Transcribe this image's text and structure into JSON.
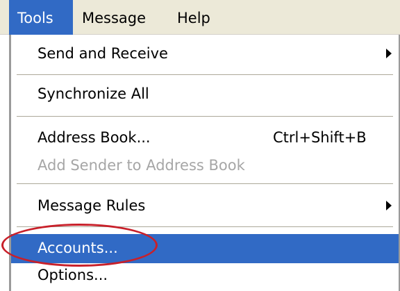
{
  "menubar": {
    "items": [
      {
        "label": "Tools",
        "active": true
      },
      {
        "label": "Message",
        "active": false
      },
      {
        "label": "Help",
        "active": false
      }
    ]
  },
  "dropdown": {
    "items": [
      {
        "label": "Send and Receive",
        "submenu": true
      },
      {
        "label": "Synchronize All"
      },
      {
        "label": "Address Book...",
        "shortcut": "Ctrl+Shift+B"
      },
      {
        "label": "Add Sender to Address Book",
        "disabled": true
      },
      {
        "label": "Message Rules",
        "submenu": true
      },
      {
        "label": "Accounts...",
        "highlighted": true
      },
      {
        "label": "Options..."
      }
    ]
  },
  "colors": {
    "highlight": "#316ac5",
    "annotation": "#c8202a",
    "disabled_text": "#a6a6a6"
  }
}
